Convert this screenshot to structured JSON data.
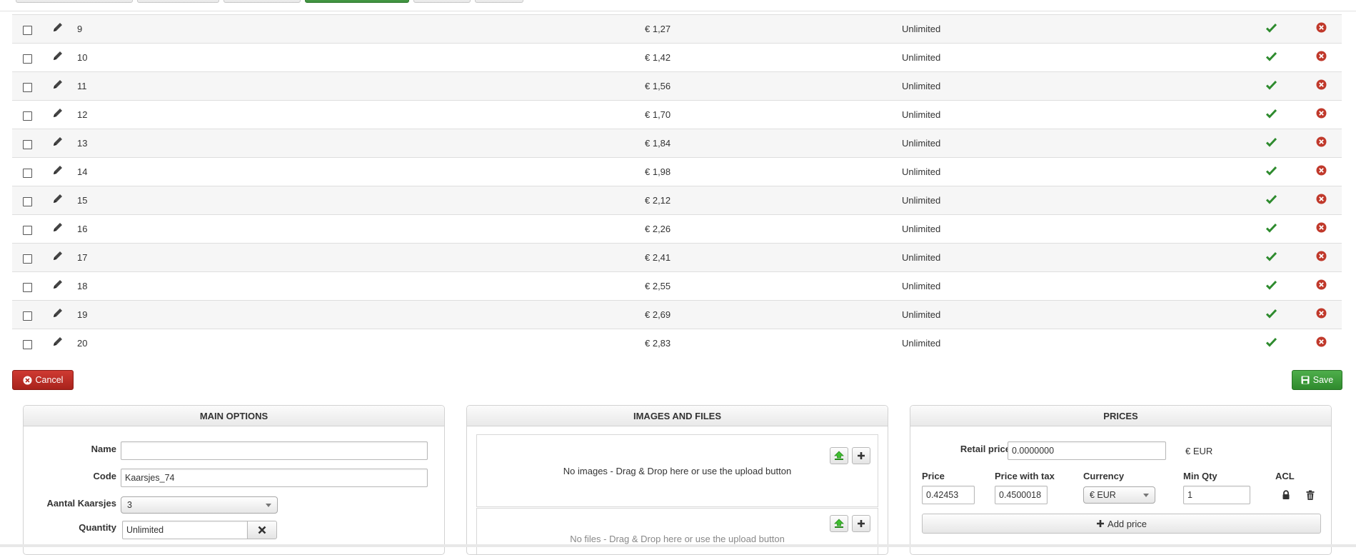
{
  "table": {
    "rows": [
      {
        "num": "9",
        "price": "€ 1,27",
        "stock": "Unlimited"
      },
      {
        "num": "10",
        "price": "€ 1,42",
        "stock": "Unlimited"
      },
      {
        "num": "11",
        "price": "€ 1,56",
        "stock": "Unlimited"
      },
      {
        "num": "12",
        "price": "€ 1,70",
        "stock": "Unlimited"
      },
      {
        "num": "13",
        "price": "€ 1,84",
        "stock": "Unlimited"
      },
      {
        "num": "14",
        "price": "€ 1,98",
        "stock": "Unlimited"
      },
      {
        "num": "15",
        "price": "€ 2,12",
        "stock": "Unlimited"
      },
      {
        "num": "16",
        "price": "€ 2,26",
        "stock": "Unlimited"
      },
      {
        "num": "17",
        "price": "€ 2,41",
        "stock": "Unlimited"
      },
      {
        "num": "18",
        "price": "€ 2,55",
        "stock": "Unlimited"
      },
      {
        "num": "19",
        "price": "€ 2,69",
        "stock": "Unlimited"
      },
      {
        "num": "20",
        "price": "€ 2,83",
        "stock": "Unlimited"
      }
    ]
  },
  "actions": {
    "cancel_label": "Cancel",
    "save_label": "Save"
  },
  "main_options": {
    "title": "MAIN OPTIONS",
    "name_label": "Name",
    "name_value": "",
    "code_label": "Code",
    "code_value": "Kaarsjes_74",
    "aantal_label": "Aantal Kaarsjes",
    "aantal_value": "3",
    "quantity_label": "Quantity",
    "quantity_value": "Unlimited"
  },
  "images_files": {
    "title": "IMAGES AND FILES",
    "images_text": "No images - Drag & Drop here or use the upload button",
    "files_text": "No files - Drag & Drop here or use the upload button"
  },
  "prices": {
    "title": "PRICES",
    "retail_label": "Retail price",
    "retail_value": "0.0000000",
    "retail_currency": "€ EUR",
    "col_price": "Price",
    "col_price_tax": "Price with tax",
    "col_currency": "Currency",
    "col_min_qty": "Min Qty",
    "col_acl": "ACL",
    "price_value": "0.42453",
    "price_tax_value": "0.4500018",
    "currency_value": "€ EUR",
    "min_qty_value": "1",
    "add_price_label": "Add price"
  },
  "colors": {
    "cancel": "#b52b23",
    "save": "#3c9a3a",
    "check": "#2e8b2e",
    "remove": "#c0392b",
    "upload": "#3fbf2f"
  }
}
